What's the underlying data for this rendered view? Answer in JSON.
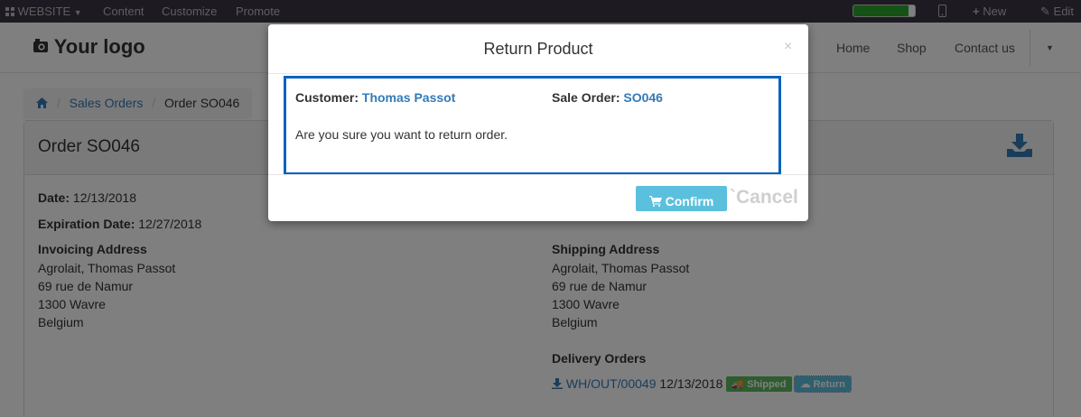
{
  "topbar": {
    "website_label": "WEBSITE",
    "menu": [
      "Content",
      "Customize",
      "Promote"
    ],
    "progress_percent": 90,
    "new_label": "New",
    "edit_label": "Edit"
  },
  "header": {
    "logo_text": "Your logo",
    "nav": [
      "Home",
      "Shop",
      "Contact us"
    ]
  },
  "breadcrumb": {
    "items": [
      "Sales Orders",
      "Order SO046"
    ]
  },
  "order": {
    "title": "Order SO046",
    "date_label": "Date:",
    "date_value": "12/13/2018",
    "expiration_label": "Expiration Date:",
    "expiration_value": "12/27/2018",
    "invoicing_label": "Invoicing Address",
    "invoicing_lines": [
      "Agrolait, Thomas Passot",
      "69 rue de Namur",
      "1300 Wavre",
      "Belgium"
    ],
    "shipping_label": "Shipping Address",
    "shipping_lines": [
      "Agrolait, Thomas Passot",
      "69 rue de Namur",
      "1300 Wavre",
      "Belgium"
    ],
    "delivery_label": "Delivery Orders",
    "delivery_ref": "WH/OUT/00049",
    "delivery_date": "12/13/2018",
    "shipped_badge": "Shipped",
    "return_badge": "Return"
  },
  "modal": {
    "title": "Return Product",
    "close_symbol": "×",
    "customer_label": "Customer:",
    "customer_value": "Thomas Passot",
    "sale_order_label": "Sale Order:",
    "sale_order_value": "SO046",
    "message": "Are you sure you want to return order.",
    "confirm_label": "Confirm",
    "cancel_label": "`Cancel"
  },
  "colors": {
    "link": "#337ab7",
    "topbar_bg": "#3a3545",
    "confirm_bg": "#5bc0de",
    "highlight_border": "#0a62c0",
    "shipped_bg": "#5cb85c",
    "return_bg": "#5bc0de"
  },
  "icons": [
    "grid-icon",
    "caret-down-icon",
    "mobile-icon",
    "plus-icon",
    "pencil-icon",
    "camera-icon",
    "home-icon",
    "download-tray-icon",
    "download-icon",
    "truck-icon",
    "cloud-upload-icon",
    "cart-icon"
  ]
}
